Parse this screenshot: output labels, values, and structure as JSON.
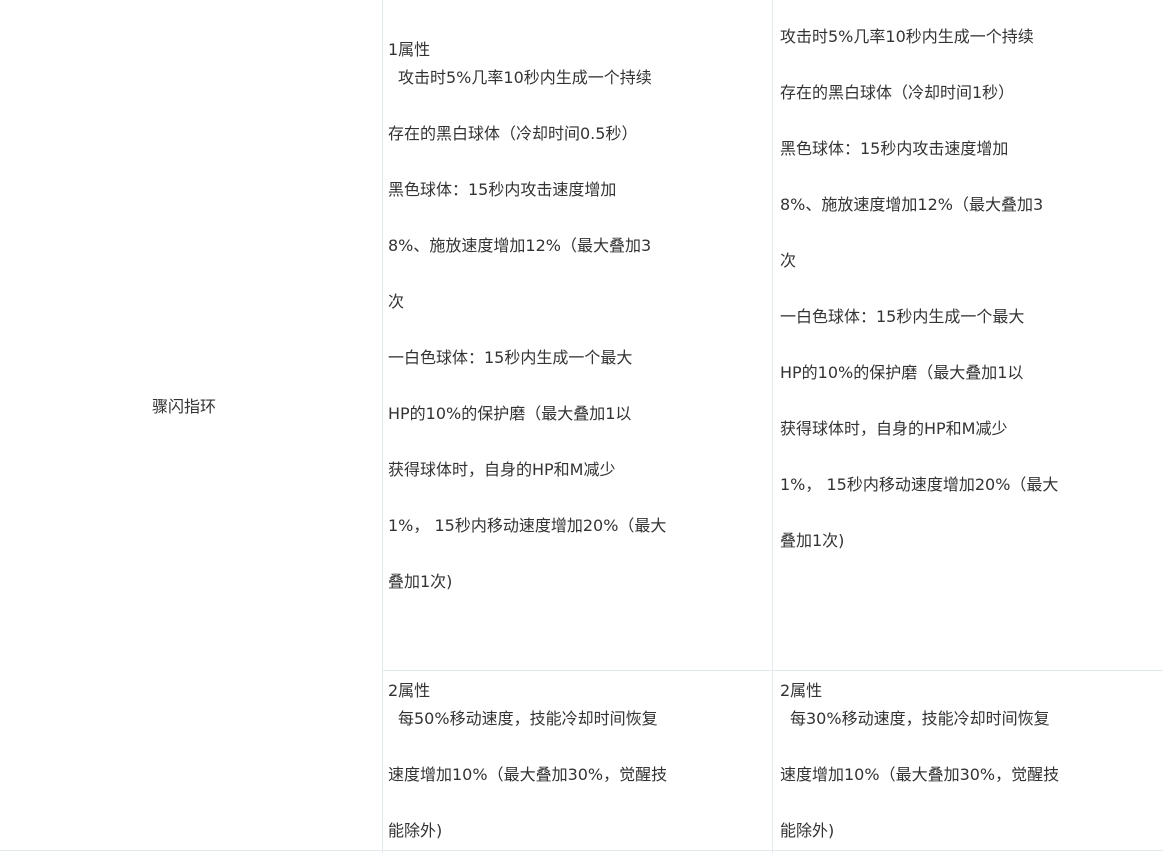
{
  "item_name": "骤闪指环",
  "row1": {
    "col1": {
      "heading": "1属性",
      "lines": [
        "攻击时5%几率10秒内生成一个持续",
        "存在的黑白球体（冷却时间0.5秒）",
        "黑色球体：15秒内攻击速度增加",
        "8%、施放速度增加12%（最大叠加3",
        "次",
        "一白色球体：15秒内生成一个最大",
        "HP的10%的保护磨（最大叠加1以",
        "获得球体时，自身的HP和M减少",
        "1%，  15秒内移动速度增加20%（最大",
        "叠加1次)"
      ]
    },
    "col2": {
      "lines": [
        "攻击时5%几率10秒内生成一个持续",
        "存在的黑白球体（冷却时间1秒）",
        "黑色球体：15秒内攻击速度增加",
        "8%、施放速度增加12%（最大叠加3",
        "次",
        "一白色球体：15秒内生成一个最大",
        "HP的10%的保护磨（最大叠加1以",
        "获得球体时，自身的HP和M减少",
        "1%，  15秒内移动速度增加20%（最大",
        "叠加1次)"
      ]
    }
  },
  "row2": {
    "col1": {
      "heading": "2属性",
      "lines": [
        "每50%移动速度，技能冷却时间恢复",
        "速度增加10%（最大叠加30%，觉醒技",
        "能除外)"
      ]
    },
    "col2": {
      "heading": "2属性",
      "lines": [
        "每30%移动速度，技能冷却时间恢复",
        "速度增加10%（最大叠加30%，觉醒技",
        "能除外)"
      ]
    }
  },
  "colors": {
    "text": "#333333",
    "border": "#e3eaee",
    "background": "#ffffff"
  }
}
